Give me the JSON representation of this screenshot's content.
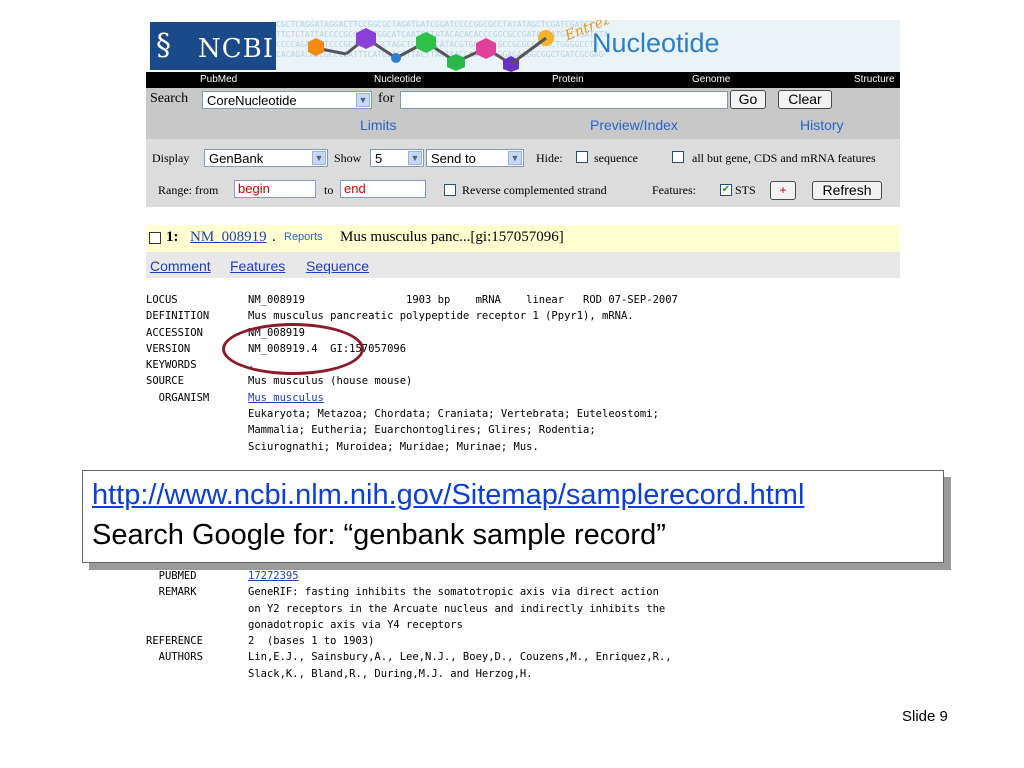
{
  "header": {
    "ncbi_logo_text": "NCBI",
    "entrez_brand": "Entrez",
    "nucleotide_brand": "Nucleotide",
    "sequence_bg": "CGCTCAGGATAGGACTTCCGGCGCTAGATGATCGGATCCCCGGCGCCTATATAGCTCGATCGATCT\nTTCTCTATTACCCCGCGCCTTGGCATCAATGATATACACACACCCGGCGCCGATAGCATGACTGATCTA\nCCCCAGAGCCTCCCGCATTCAGCTAGCTCTTCGCATACGTGGCGCCGCCGCGCCCTACTGGGGCCTA\nCACAGACAGCGCCCCATTTCATGCACATTACTTACTAACCAATTCGGGAGACGGCGGCTGATCGCGAG"
  },
  "nav": {
    "items": [
      "PubMed",
      "Nucleotide",
      "Protein",
      "Genome",
      "Structure"
    ]
  },
  "search": {
    "label": "Search",
    "database": "CoreNucleotide",
    "for_label": "for",
    "query": "",
    "go_label": "Go",
    "clear_label": "Clear"
  },
  "limits": {
    "limits_label": "Limits",
    "preview_label": "Preview/Index",
    "history_label": "History"
  },
  "display": {
    "display_label": "Display",
    "format": "GenBank",
    "show_label": "Show",
    "show_count": "5",
    "send_to": "Send to",
    "hide_label": "Hide:",
    "sequence_label": "sequence",
    "all_but_label": "all but gene, CDS and mRNA features"
  },
  "range": {
    "from_label": "Range: from",
    "from_value": "begin",
    "to_label": "to",
    "to_value": "end",
    "reverse_label": "Reverse complemented strand",
    "features_label": "Features:",
    "sts_label": "STS",
    "plus_label": "+",
    "refresh_label": "Refresh"
  },
  "result": {
    "index": "1:",
    "accession": "NM_008919",
    "reports": "Reports",
    "title": "Mus musculus panc...[gi:157057096]",
    "links": [
      "Comment",
      "Features",
      "Sequence"
    ]
  },
  "record": {
    "lines": [
      {
        "key": "LOCUS",
        "value": "NM_008919                1903 bp    mRNA    linear   ROD 07-SEP-2007"
      },
      {
        "key": "DEFINITION",
        "value": "Mus musculus pancreatic polypeptide receptor 1 (Ppyr1), mRNA."
      },
      {
        "key": "ACCESSION",
        "value": "NM_008919"
      },
      {
        "key": "VERSION",
        "value": "NM_008919.4  GI:157057096"
      },
      {
        "key": "KEYWORDS",
        "value": "."
      },
      {
        "key": "SOURCE",
        "value": "Mus musculus (house mouse)"
      },
      {
        "key": "  ORGANISM",
        "value": "Mus musculus"
      },
      {
        "key": "",
        "value": "Eukaryota; Metazoa; Chordata; Craniata; Vertebrata; Euteleostomi;"
      },
      {
        "key": "",
        "value": "Mammalia; Eutheria; Euarchontoglires; Glires; Rodentia;"
      },
      {
        "key": "",
        "value": "Sciurognathi; Muroidea; Muridae; Murinae; Mus."
      }
    ],
    "lines_lower": [
      {
        "key": "  PUBMED",
        "value": "17272395"
      },
      {
        "key": "  REMARK",
        "value": "GeneRIF: fasting inhibits the somatotropic axis via direct action"
      },
      {
        "key": "",
        "value": "on Y2 receptors in the Arcuate nucleus and indirectly inhibits the"
      },
      {
        "key": "",
        "value": "gonadotropic axis via Y4 receptors"
      },
      {
        "key": "REFERENCE",
        "value": "2  (bases 1 to 1903)"
      },
      {
        "key": "  AUTHORS",
        "value": "Lin,E.J., Sainsbury,A., Lee,N.J., Boey,D., Couzens,M., Enriquez,R.,"
      },
      {
        "key": "",
        "value": "Slack,K., Bland,R., During,M.J. and Herzog,H."
      }
    ]
  },
  "callout": {
    "url": "http://www.ncbi.nlm.nih.gov/Sitemap/samplerecord.html",
    "hint": "Search Google for: “genbank sample record”"
  },
  "slide": {
    "number": "Slide 9"
  }
}
